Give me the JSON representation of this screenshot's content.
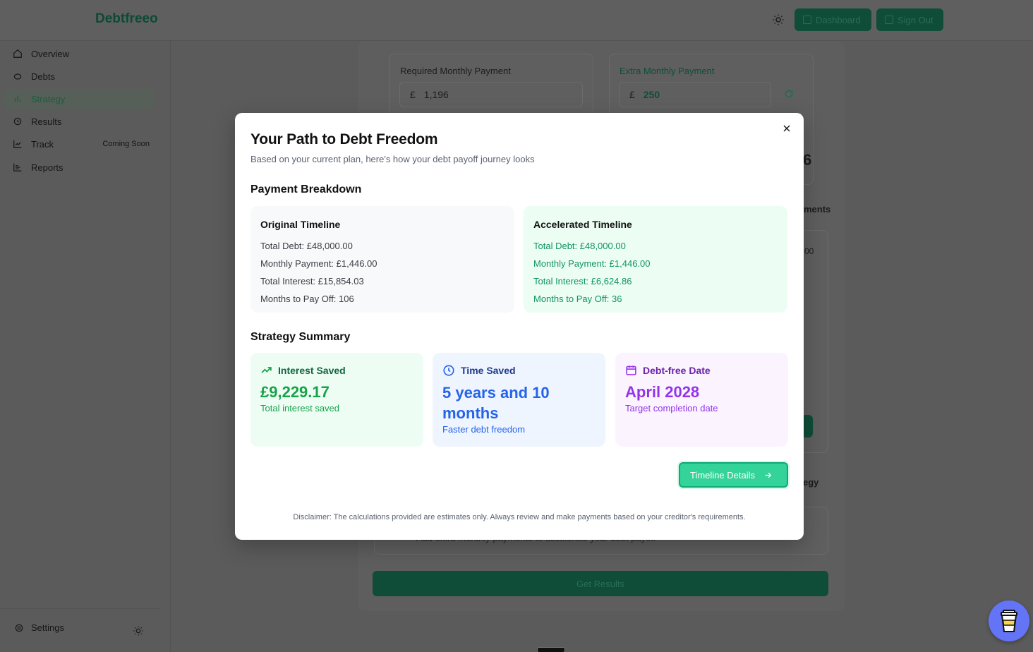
{
  "app": {
    "brand": "Debtfreeo"
  },
  "header": {
    "dashboard_label": "Dashboard",
    "signout_label": "Sign Out"
  },
  "sidebar": {
    "items": [
      {
        "label": "Overview",
        "icon": "home-icon"
      },
      {
        "label": "Debts",
        "icon": "piggy-bank-icon"
      },
      {
        "label": "Strategy",
        "icon": "bar-chart-icon",
        "active": true
      },
      {
        "label": "Results",
        "icon": "history-icon"
      },
      {
        "label": "Track",
        "icon": "line-chart-icon",
        "badge": "Coming Soon"
      },
      {
        "label": "Reports",
        "icon": "report-icon"
      }
    ],
    "settings_label": "Settings"
  },
  "background": {
    "required_label": "Required Monthly Payment",
    "currency": "£",
    "required_value": "1,196",
    "extra_label": "Extra Monthly Payment",
    "extra_value": "250",
    "frag_6": "6",
    "frag_ments": "ments",
    "frag_00": "00",
    "frag_egy": "egy",
    "frag_sub": "Add extra monthly payments to accelerate your debt payoff",
    "get_results": "Get Results"
  },
  "modal": {
    "title": "Your Path to Debt Freedom",
    "subtitle": "Based on your current plan, here's how your debt payoff journey looks",
    "breakdown_title": "Payment Breakdown",
    "original": {
      "title": "Original Timeline",
      "rows": [
        "Total Debt: £48,000.00",
        "Monthly Payment: £1,446.00",
        "Total Interest: £15,854.03",
        "Months to Pay Off: 106"
      ]
    },
    "accelerated": {
      "title": "Accelerated Timeline",
      "rows": [
        "Total Debt: £48,000.00",
        "Monthly Payment: £1,446.00",
        "Total Interest: £6,624.86",
        "Months to Pay Off: 36"
      ]
    },
    "summary_title": "Strategy Summary",
    "summary": {
      "interest": {
        "label": "Interest Saved",
        "value": "£9,229.17",
        "caption": "Total interest saved"
      },
      "time": {
        "label": "Time Saved",
        "value": "5 years and 10 months",
        "caption": "Faster debt freedom"
      },
      "date": {
        "label": "Debt-free Date",
        "value": "April 2028",
        "caption": "Target completion date"
      }
    },
    "timeline_button": "Timeline Details",
    "disclaimer": "Disclaimer: The calculations provided are estimates only. Always review and make payments based on your creditor's requirements."
  },
  "colors": {
    "accent": "#34d39a",
    "brand": "#0f4d38",
    "interest": "#16a34a",
    "time": "#2563eb",
    "date": "#9333ea"
  }
}
